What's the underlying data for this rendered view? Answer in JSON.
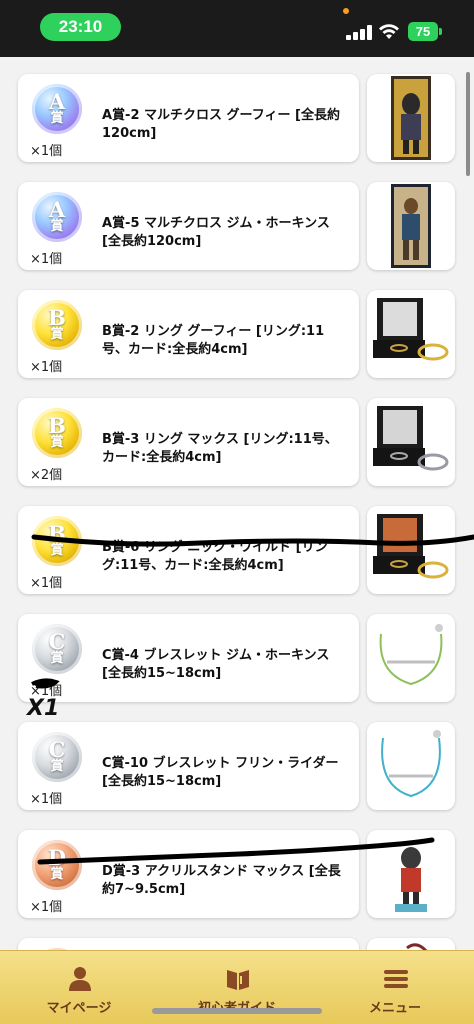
{
  "status_bar": {
    "time": "23:10",
    "battery": "75"
  },
  "prizes": [
    {
      "grade": "A",
      "kanji": "賞",
      "title": "A賞-2 マルチクロス グーフィー [全長約120cm]",
      "qty": "×1個",
      "tier": "A",
      "struck": false
    },
    {
      "grade": "A",
      "kanji": "賞",
      "title": "A賞-5 マルチクロス ジム・ホーキンス [全長約120cm]",
      "qty": "×1個",
      "tier": "A",
      "struck": false
    },
    {
      "grade": "B",
      "kanji": "賞",
      "title": "B賞-2 リング グーフィー [リング:11号、カード:全長約4cm]",
      "qty": "×1個",
      "tier": "B",
      "struck": false
    },
    {
      "grade": "B",
      "kanji": "賞",
      "title": "B賞-3 リング マックス [リング:11号、カード:全長約4cm]",
      "qty": "×2個",
      "tier": "B",
      "struck": false
    },
    {
      "grade": "B",
      "kanji": "賞",
      "title": "B賞-6 リング ニック・ワイルド [リング:11号、カード:全長約4cm]",
      "qty": "×1個",
      "tier": "B",
      "struck": true
    },
    {
      "grade": "C",
      "kanji": "賞",
      "title": "C賞-4 ブレスレット ジム・ホーキンス [全長約15~18cm]",
      "qty": "×1個",
      "tier": "C",
      "struck": false
    },
    {
      "grade": "C",
      "kanji": "賞",
      "title": "C賞-10 ブレスレット フリン・ライダー [全長約15~18cm]",
      "qty": "×1個",
      "tier": "C",
      "struck": false
    },
    {
      "grade": "D",
      "kanji": "賞",
      "title": "D賞-3 アクリルスタンド マックス [全長約7~9.5cm]",
      "qty": "×1個",
      "tier": "D",
      "struck": true
    }
  ],
  "handwritten_note": "X1",
  "bottom_nav": {
    "mypage": "マイページ",
    "guide": "初心者ガイド",
    "menu": "メニュー"
  },
  "colors": {
    "nav_bg": "#f0d670",
    "nav_text": "#6b3a1a",
    "status_green": "#2fd15d"
  }
}
